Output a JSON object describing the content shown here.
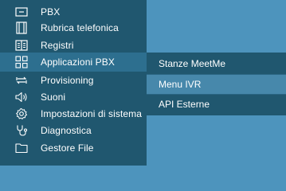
{
  "sidebar": {
    "items": [
      {
        "label": "PBX",
        "icon": "pbx-icon"
      },
      {
        "label": "Rubrica telefonica",
        "icon": "phonebook-icon"
      },
      {
        "label": "Registri",
        "icon": "registers-icon"
      },
      {
        "label": "Applicazioni PBX",
        "icon": "apps-grid-icon",
        "active": true
      },
      {
        "label": "Provisioning",
        "icon": "provisioning-icon"
      },
      {
        "label": "Suoni",
        "icon": "speaker-icon"
      },
      {
        "label": "Impostazioni di sistema",
        "icon": "gear-icon"
      },
      {
        "label": "Diagnostica",
        "icon": "diagnostics-icon"
      },
      {
        "label": "Gestore File",
        "icon": "folder-icon"
      }
    ]
  },
  "submenu": {
    "items": [
      {
        "label": "Stanze MeetMe"
      },
      {
        "label": "Menu IVR",
        "highlighted": true
      },
      {
        "label": "API Esterne"
      }
    ]
  },
  "colors": {
    "sidebar_bg": "#20576f",
    "active_item_bg": "#2d6f8f",
    "submenu_highlight": "#4788ab",
    "page_bg": "#4d94bd",
    "text": "#ffffff"
  }
}
